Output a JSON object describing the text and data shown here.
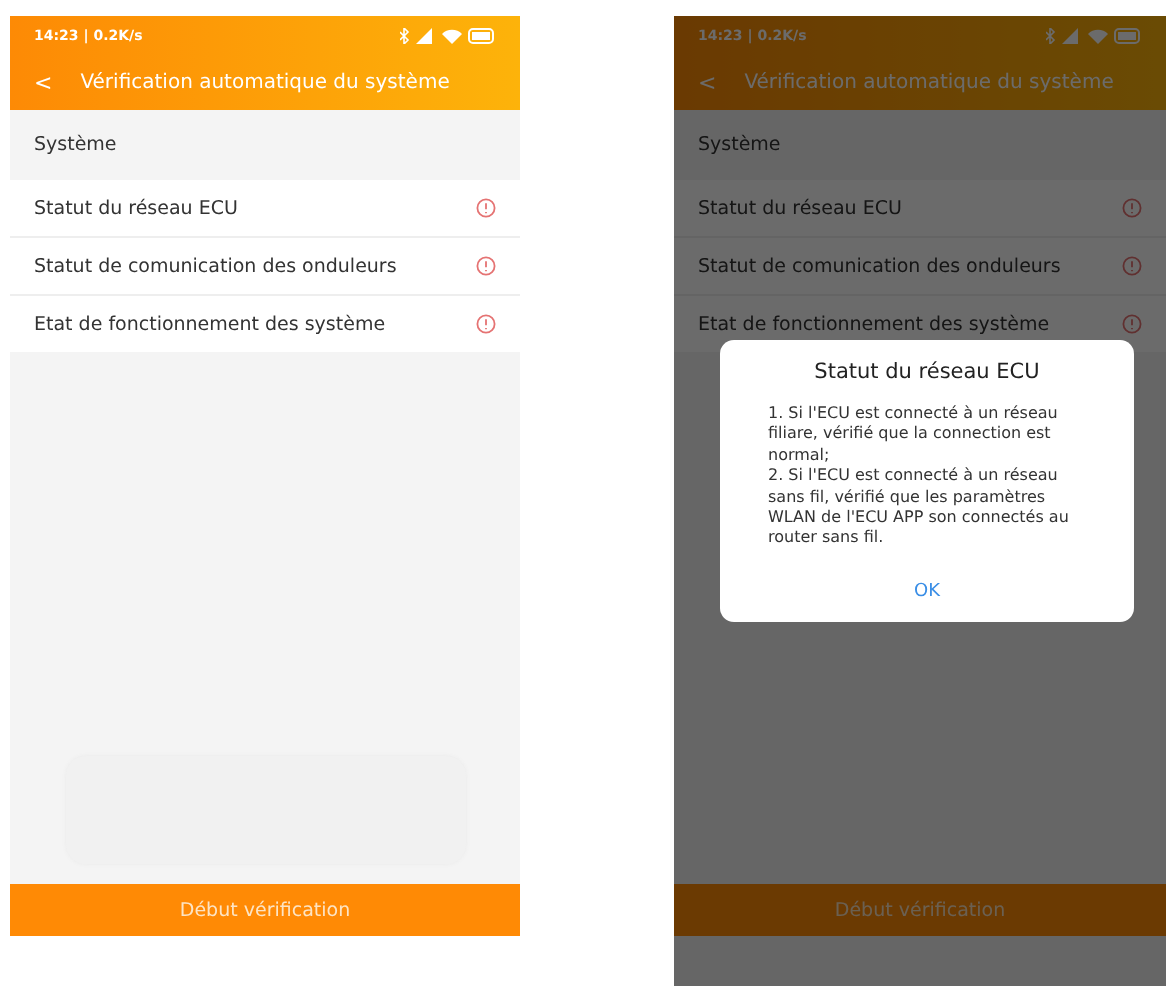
{
  "screens": [
    {
      "dimmed": false,
      "status": "14:23 | 0.2K/s",
      "back": "<",
      "title": "Vérification automatique du système",
      "section": "Système",
      "items": [
        "Statut du réseau ECU",
        "Statut de comunication des onduleurs",
        "Etat de fonctionnement des système"
      ],
      "button": "Début vérification"
    },
    {
      "dimmed": true,
      "status": "14:23 | 0.2K/s",
      "back": "<",
      "title": "Vérification automatique du système",
      "section": "Système",
      "items": [
        "Statut du réseau ECU",
        "Statut de comunication des onduleurs",
        "Etat de fonctionnement des système"
      ],
      "button": "Début vérification",
      "dialog": {
        "title": "Statut du réseau ECU",
        "paragraphs": [
          "1. Si l'ECU est connecté à un réseau filiare, vérifié que la connection est normal;",
          "2. Si l'ECU est connecté à un réseau sans fil, vérifié que les paramètres WLAN de l'ECU APP son connectés au router sans fil."
        ],
        "ok": "OK"
      }
    }
  ]
}
